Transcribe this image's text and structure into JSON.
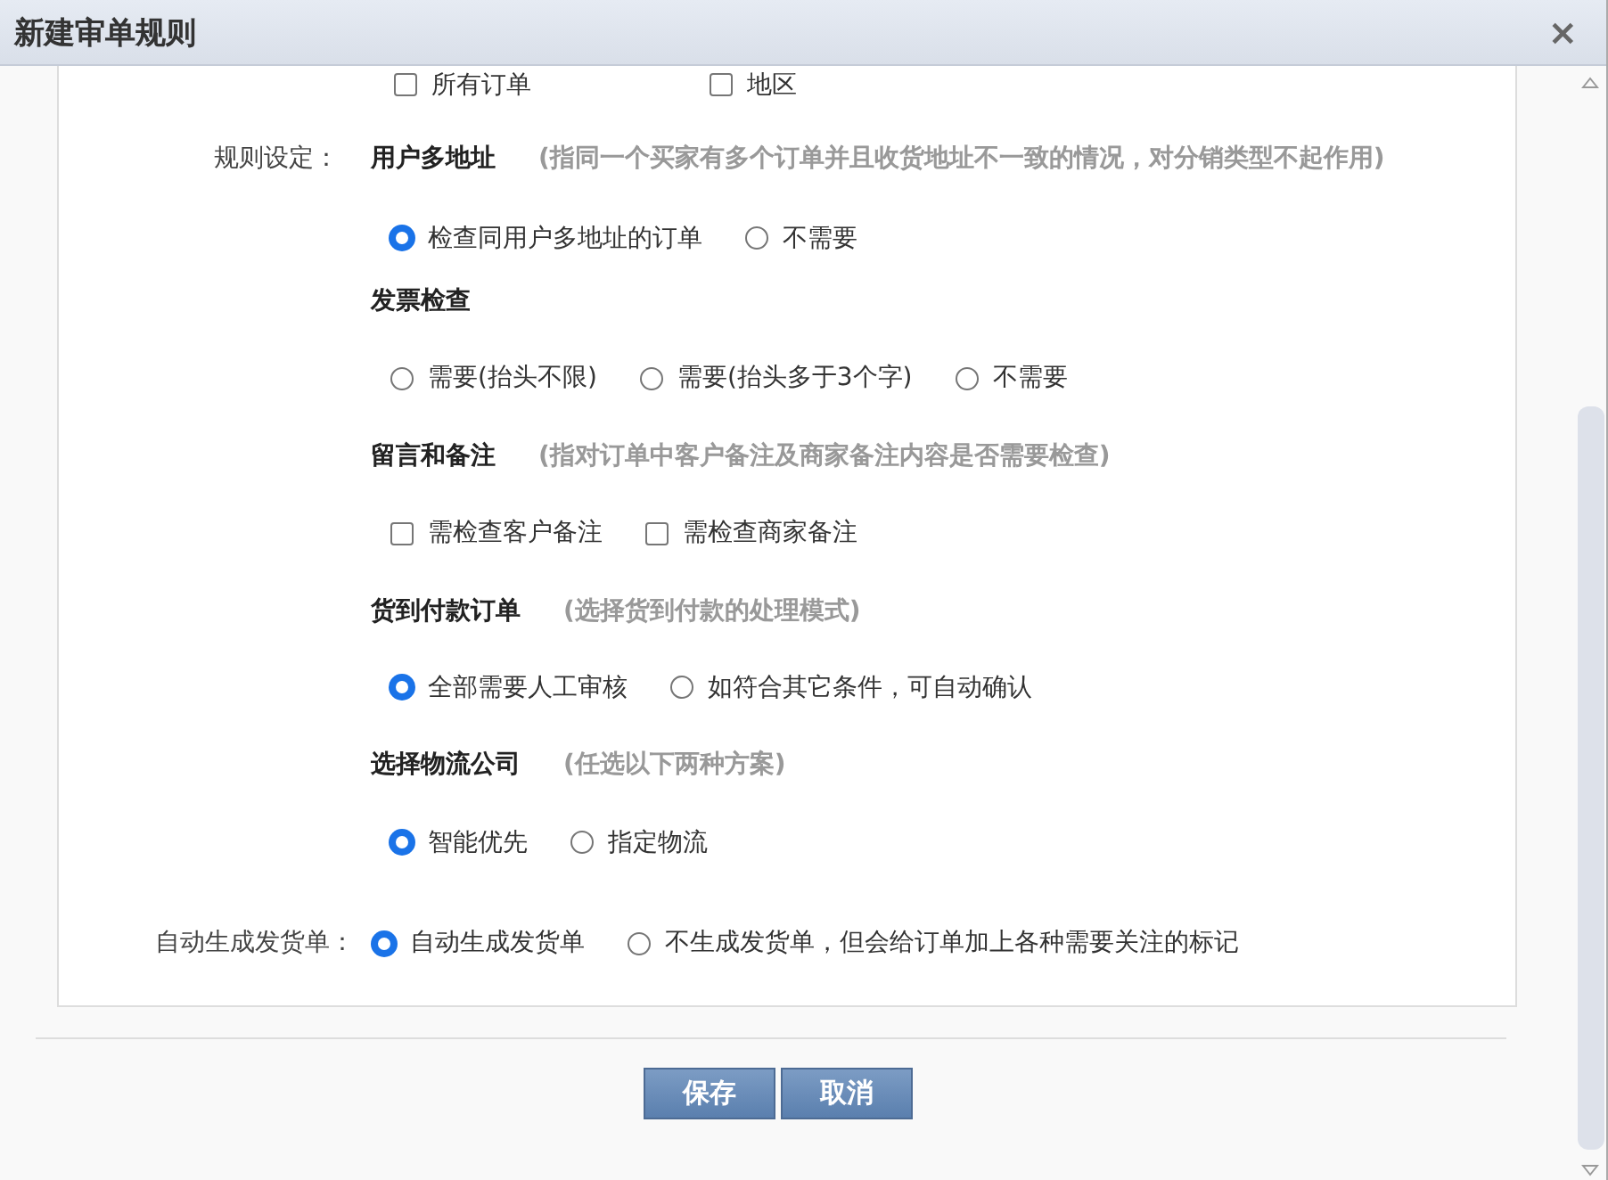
{
  "dialog": {
    "title": "新建审单规则",
    "close": "×"
  },
  "scope_options": [
    {
      "label": "所有订单",
      "checked": false
    },
    {
      "label": "地区",
      "checked": false
    }
  ],
  "rule_settings": {
    "label": "规则设定：",
    "sections": [
      {
        "kind": "radio",
        "title": "用户多地址",
        "hint": "(指同一个买家有多个订单并且收货地址不一致的情况，对分销类型不起作用)",
        "options": [
          {
            "label": "检查同用户多地址的订单",
            "selected": true
          },
          {
            "label": "不需要",
            "selected": false
          }
        ]
      },
      {
        "kind": "radio",
        "title": "发票检查",
        "options": [
          {
            "label": "需要(抬头不限)",
            "selected": false
          },
          {
            "label": "需要(抬头多于3个字)",
            "selected": false
          },
          {
            "label": "不需要",
            "selected": false
          }
        ]
      },
      {
        "kind": "checkbox",
        "title": "留言和备注",
        "hint": "(指对订单中客户备注及商家备注内容是否需要检查)",
        "options": [
          {
            "label": "需检查客户备注",
            "checked": false
          },
          {
            "label": "需检查商家备注",
            "checked": false
          }
        ]
      },
      {
        "kind": "radio",
        "title": "货到付款订单",
        "hint": "(选择货到付款的处理模式)",
        "options": [
          {
            "label": "全部需要人工审核",
            "selected": true
          },
          {
            "label": "如符合其它条件，可自动确认",
            "selected": false
          }
        ]
      },
      {
        "kind": "radio",
        "title": "选择物流公司",
        "hint": "(任选以下两种方案)",
        "options": [
          {
            "label": "智能优先",
            "selected": true
          },
          {
            "label": "指定物流",
            "selected": false
          }
        ]
      }
    ]
  },
  "delivery_note": {
    "label": "自动生成发货单：",
    "options": [
      {
        "label": "自动生成发货单",
        "selected": true
      },
      {
        "label": "不生成发货单，但会给订单加上各种需要关注的标记",
        "selected": false
      }
    ]
  },
  "buttons": [
    "保存",
    "取消"
  ]
}
